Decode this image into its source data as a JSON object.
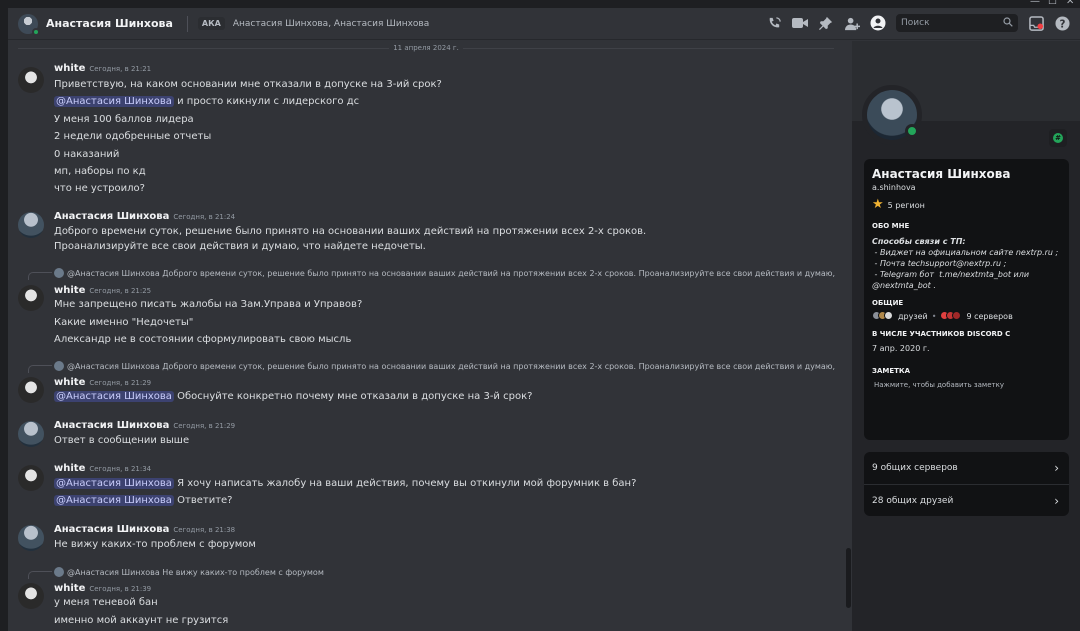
{
  "colors": {
    "background": "#313338",
    "mention": "#3c4270",
    "online": "#23a55a",
    "sidebar": "#232428"
  },
  "window_controls": {
    "minimize": "—",
    "maximize": "☐",
    "close": "✕"
  },
  "header": {
    "name": "Анастасия Шинхова",
    "aka_label": "АКА",
    "aka_names": "Анастасия Шинхова, Анастасия Шинхова",
    "search_placeholder": "Поиск",
    "icons": [
      "phone-call-icon",
      "video-call-icon",
      "pin-icon",
      "add-friend-icon",
      "profile-toggle-icon",
      "inbox-icon",
      "help-icon"
    ]
  },
  "chat": {
    "date_divider": "11 апреля 2024 г.",
    "messages": [
      {
        "author": "white",
        "time": "Сегодня, в 21:21",
        "lines": [
          "Приветствую, на каком основании мне отказали в допуске на 3-ий срок?",
          "и просто кикнули с лидерского дс",
          "У меня 100 баллов лидера",
          "2 недели одобренные отчеты",
          "0 наказаний",
          "мп, наборы по кд",
          "что не устроило?"
        ],
        "mention": "@Анастасия Шинхова"
      },
      {
        "author": "Анастасия Шинхова",
        "time": "Сегодня, в 21:24",
        "lines": [
          "Доброго времени суток, решение было принято на основании ваших действий на протяжении всех 2-х сроков.",
          "Проанализируйте все свои действия и думаю, что найдете недочеты."
        ]
      },
      {
        "reply_author": "@Анастасия Шинхова",
        "reply_text": "Доброго времени суток, решение было принято на основании ваших действий на протяжении всех 2-х сроков. Проанализируйте все свои действия и думаю,",
        "author": "white",
        "time": "Сегодня, в 21:25",
        "lines": [
          "Мне запрещено писать жалобы на Зам.Управа и Управов?",
          "Какие именно \"Недочеты\"",
          "Александр не в состоянии сформулировать свою мысль"
        ]
      },
      {
        "reply_author": "@Анастасия Шинхова",
        "reply_text": "Доброго времени суток, решение было принято на основании ваших действий на протяжении всех 2-х сроков. Проанализируйте все свои действия и думаю,",
        "author": "white",
        "time": "Сегодня, в 21:29",
        "mention": "@Анастасия Шинхова",
        "lines": [
          "Обоснуйте конкретно почему мне отказали в допуске на 3-й срок?"
        ]
      },
      {
        "author": "Анастасия Шинхова",
        "time": "Сегодня, в 21:29",
        "lines": [
          "Ответ в сообщении выше"
        ]
      },
      {
        "author": "white",
        "time": "Сегодня, в 21:34",
        "mention": "@Анастасия Шинхова",
        "lines": [
          "Я хочу написать жалобу на ваши действия, почему вы откинули мой форумник в бан?",
          "Ответите?"
        ]
      },
      {
        "author": "Анастасия Шинхова",
        "time": "Сегодня, в 21:38",
        "lines": [
          "Не вижу каких-то проблем с форумом"
        ]
      },
      {
        "reply_author": "@Анастасия Шинхова",
        "reply_text": "Не вижу каких-то проблем с форумом",
        "author": "white",
        "time": "Сегодня, в 21:39",
        "lines": [
          "у меня теневой бан",
          "именно мой аккаунт не грузится"
        ]
      }
    ]
  },
  "profile": {
    "name": "Анастасия Шинхова",
    "username": "a.shinhova",
    "region": "5 регион",
    "about_title": "ОБО МНЕ",
    "about_heading": "Способы связи с ТП:",
    "about_lines": [
      " - Виджет на официальном сайте nextrp.ru ;",
      " - Почта techsupport@nextrp.ru ;",
      " - Telegram бот  t.me/nextmta_bot или",
      "@nextmta_bot ."
    ],
    "common_title": "ОБЩИЕ",
    "common_friends": "друзей",
    "common_servers": "9 серверов",
    "member_title": "В ЧИСЛЕ УЧАСТНИКОВ DISCORD С",
    "member_since": "7 апр. 2020 г.",
    "note_title": "ЗАМЕТКА",
    "note_hint": "Нажмите, чтобы добавить заметку",
    "mutual_servers": "9 общих серверов",
    "mutual_friends": "28 общих друзей",
    "badge": "#"
  }
}
